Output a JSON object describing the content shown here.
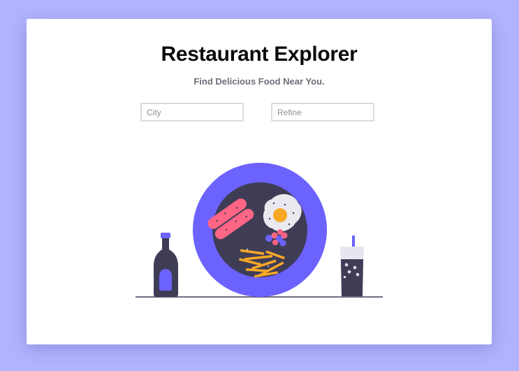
{
  "header": {
    "title": "Restaurant Explorer",
    "subtitle": "Find Delicious Food Near You."
  },
  "search": {
    "city_placeholder": "City",
    "city_value": "",
    "refine_placeholder": "Refine",
    "refine_value": ""
  },
  "colors": {
    "background": "#b1b3fe",
    "card": "#ffffff",
    "accent": "#6c63ff",
    "plate_inner": "#3f3d56",
    "sausage": "#ff6584",
    "fries": "#f9a826"
  },
  "illustration": {
    "icons": [
      "sauce-bottle-icon",
      "plate-icon",
      "drink-glass-icon"
    ]
  }
}
